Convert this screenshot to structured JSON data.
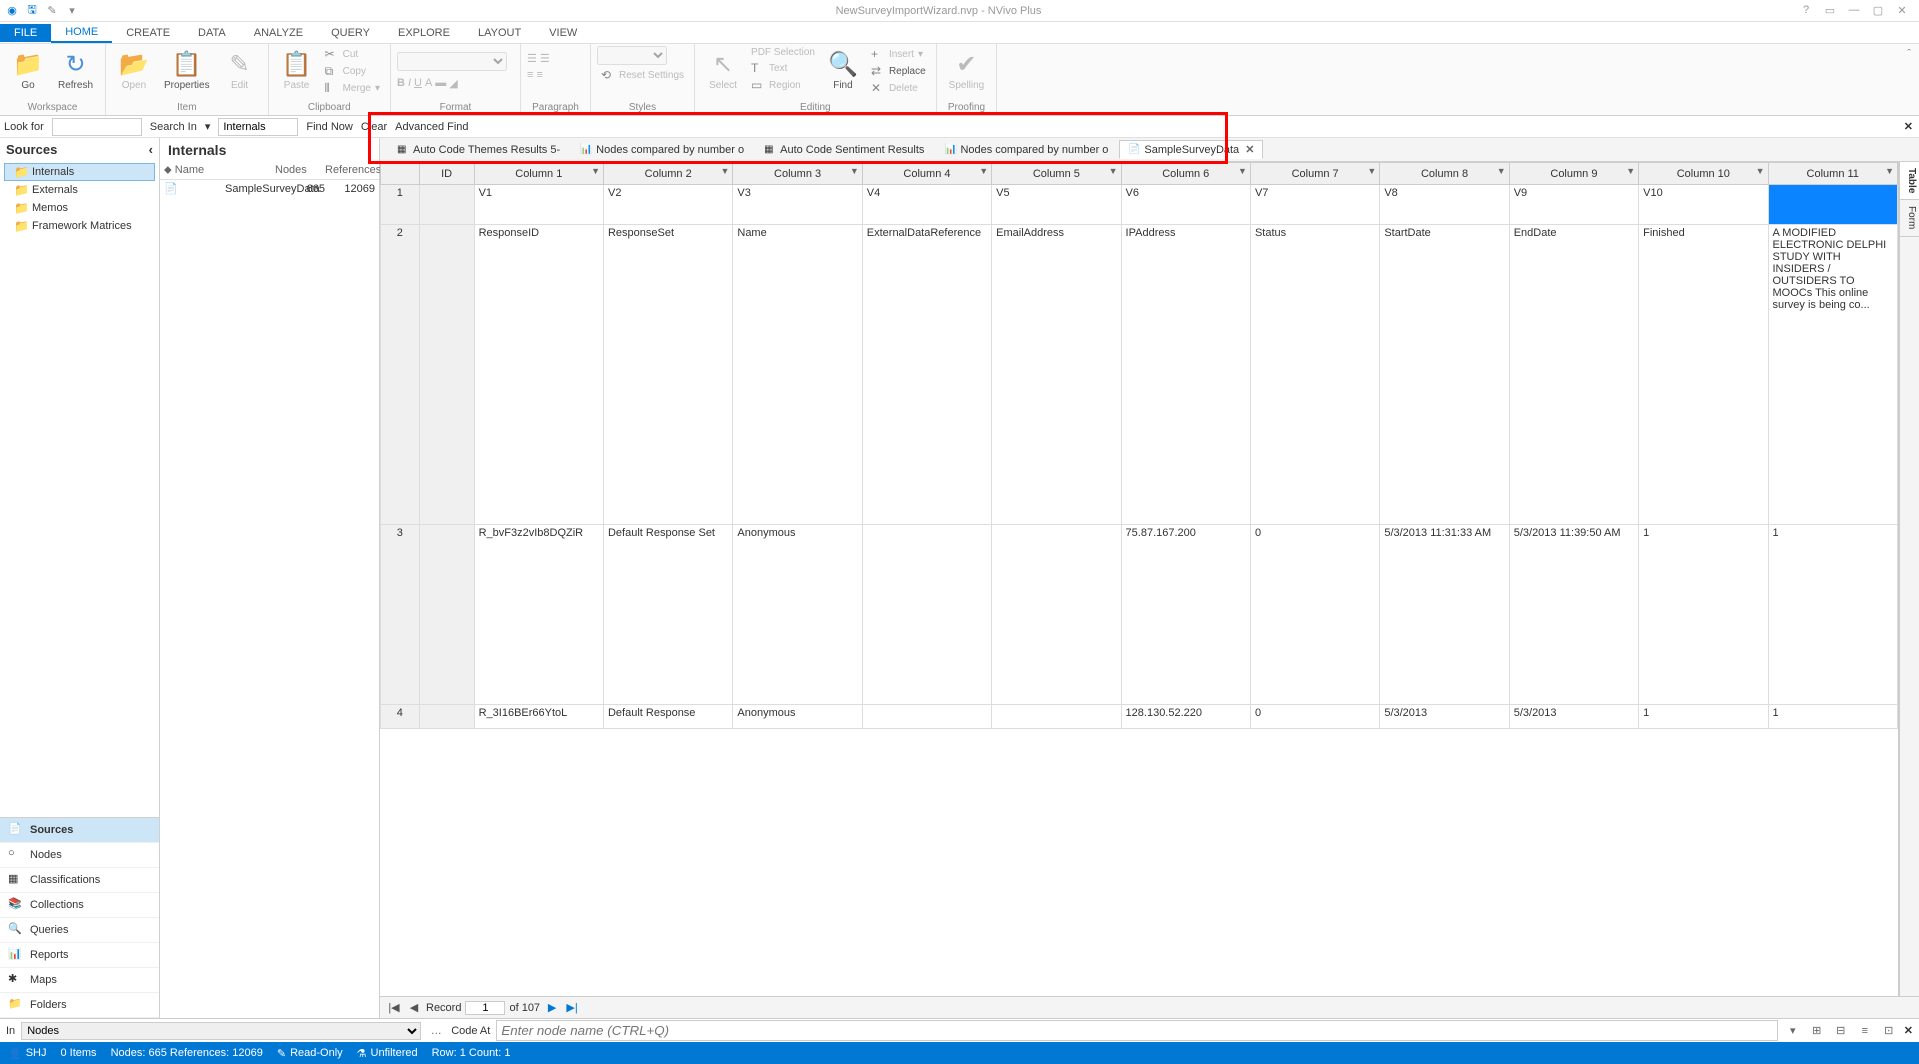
{
  "titlebar": {
    "title": "NewSurveyImportWizard.nvp - NVivo Plus"
  },
  "ribbon_tabs": [
    "FILE",
    "HOME",
    "CREATE",
    "DATA",
    "ANALYZE",
    "QUERY",
    "EXPLORE",
    "LAYOUT",
    "VIEW"
  ],
  "ribbon": {
    "workspace": {
      "label": "Workspace",
      "go": "Go",
      "refresh": "Refresh"
    },
    "item": {
      "label": "Item",
      "open": "Open",
      "properties": "Properties",
      "edit": "Edit"
    },
    "clipboard": {
      "label": "Clipboard",
      "paste": "Paste",
      "cut": "Cut",
      "copy": "Copy",
      "merge": "Merge"
    },
    "format": {
      "label": "Format",
      "reset": "Reset Settings"
    },
    "paragraph": {
      "label": "Paragraph"
    },
    "styles": {
      "label": "Styles"
    },
    "editing": {
      "label": "Editing",
      "select": "Select",
      "find": "Find",
      "pdfselection": "PDF Selection",
      "text": "Text",
      "region": "Region",
      "insert": "Insert",
      "replace": "Replace",
      "delete": "Delete"
    },
    "proofing": {
      "label": "Proofing",
      "spelling": "Spelling"
    }
  },
  "findbar": {
    "lookfor": "Look for",
    "searchin": "Search In",
    "searchin_value": "Internals",
    "findnow": "Find Now",
    "clear": "Clear",
    "advanced": "Advanced Find"
  },
  "sources_header": "Sources",
  "tree": [
    {
      "label": "Internals",
      "selected": true
    },
    {
      "label": "Externals"
    },
    {
      "label": "Memos"
    },
    {
      "label": "Framework Matrices"
    }
  ],
  "nav": [
    {
      "label": "Sources",
      "active": true
    },
    {
      "label": "Nodes"
    },
    {
      "label": "Classifications"
    },
    {
      "label": "Collections"
    },
    {
      "label": "Queries"
    },
    {
      "label": "Reports"
    },
    {
      "label": "Maps"
    },
    {
      "label": "Folders"
    }
  ],
  "mid": {
    "title": "Internals",
    "cols": [
      "Name",
      "Nodes",
      "References"
    ],
    "row": {
      "name": "SampleSurveyData",
      "nodes": "665",
      "refs": "12069"
    }
  },
  "doc_tabs": [
    {
      "label": "Auto Code Themes Results 5-"
    },
    {
      "label": "Nodes compared by number o"
    },
    {
      "label": "Auto Code Sentiment Results"
    },
    {
      "label": "Nodes compared by number o"
    },
    {
      "label": "SampleSurveyData",
      "active": true
    }
  ],
  "grid": {
    "headers": [
      "ID",
      "Column 1",
      "Column 2",
      "Column 3",
      "Column 4",
      "Column 5",
      "Column 6",
      "Column 7",
      "Column 8",
      "Column 9",
      "Column 10",
      "Column 11"
    ],
    "rows": [
      {
        "id": "1",
        "cells": [
          "V1",
          "V2",
          "V3",
          "V4",
          "V5",
          "V6",
          "V7",
          "V8",
          "V9",
          "V10",
          ""
        ]
      },
      {
        "id": "2",
        "cells": [
          "ResponseID",
          "ResponseSet",
          "Name",
          "ExternalDataReference",
          "EmailAddress",
          "IPAddress",
          "Status",
          "StartDate",
          "EndDate",
          "Finished",
          "A MODIFIED ELECTRONIC DELPHI STUDY WITH INSIDERS / OUTSIDERS TO MOOCs This online survey is being co..."
        ]
      },
      {
        "id": "3",
        "cells": [
          "R_bvF3z2vIb8DQZiR",
          "Default Response Set",
          "Anonymous",
          "",
          "",
          "75.87.167.200",
          "0",
          "5/3/2013 11:31:33 AM",
          "5/3/2013 11:39:50 AM",
          "1",
          "1"
        ]
      },
      {
        "id": "4",
        "cells": [
          "R_3I16BEr66YtoL",
          "Default Response",
          "Anonymous",
          "",
          "",
          "128.130.52.220",
          "0",
          "5/3/2013",
          "5/3/2013",
          "1",
          "1"
        ]
      }
    ]
  },
  "side_tabs": [
    "Table",
    "Form"
  ],
  "recordbar": {
    "label": "Record",
    "current": "1",
    "total": "of 107"
  },
  "nodebar": {
    "in": "In",
    "in_value": "Nodes",
    "codeat": "Code At",
    "placeholder": "Enter node name (CTRL+Q)"
  },
  "statusbar": {
    "user": "SHJ",
    "items": "0 Items",
    "nodes": "Nodes: 665 References: 12069",
    "readonly": "Read-Only",
    "unfiltered": "Unfiltered",
    "rowcount": "Row: 1 Count: 1"
  }
}
